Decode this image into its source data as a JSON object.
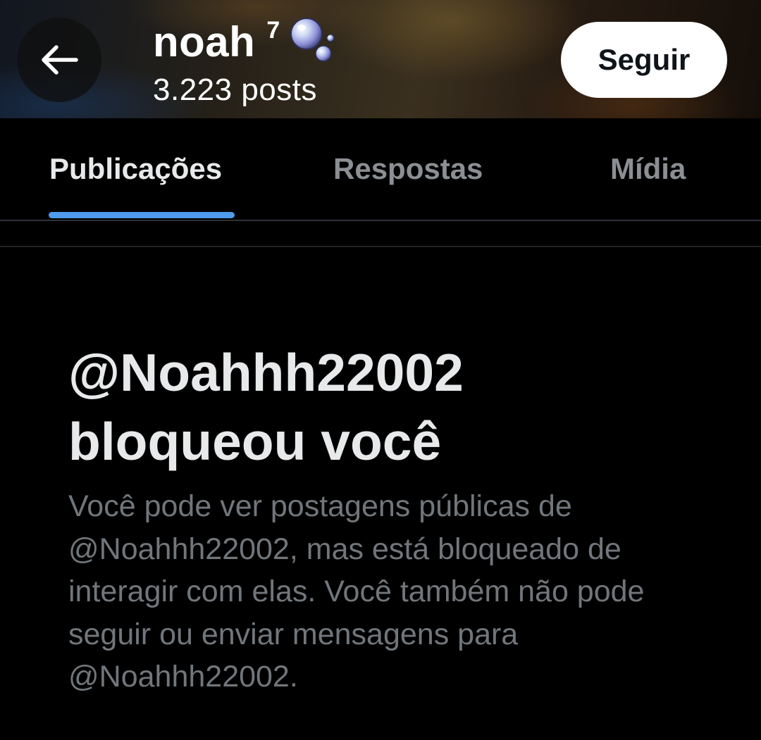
{
  "header": {
    "profile_name": "noah",
    "superscript": "7",
    "emoji_icon": "bubbles-icon",
    "post_count": "3.223 posts",
    "back_icon": "arrow-left-icon",
    "follow_label": "Seguir"
  },
  "tabs": [
    {
      "label": "Publicações",
      "active": true
    },
    {
      "label": "Respostas",
      "active": false
    },
    {
      "label": "Mídia",
      "active": false
    }
  ],
  "blocked": {
    "title": "@Noahhh22002 bloqueou você",
    "description": "Você pode ver postagens públicas de @Noahhh22002, mas está bloqueado de interagir com elas. Você também não pode seguir ou enviar mensagens para @Noahhh22002."
  },
  "colors": {
    "accent": "#4d9bea",
    "background": "#000000",
    "text_primary": "#e7e9ea",
    "text_secondary": "#71767b"
  }
}
